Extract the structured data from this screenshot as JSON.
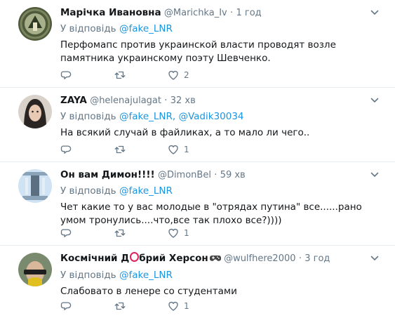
{
  "tweets": [
    {
      "name": "Марічка Ивановна",
      "handle": "@Marichka_Iv",
      "dot": "·",
      "time": "1 год",
      "reply_prefix": "У відповідь",
      "reply_mentions": [
        "@fake_LNR"
      ],
      "text": "Перфомапс против украинской власти проводят возле памятника украинскому поэту Шевченко.",
      "likes": "2",
      "retweets": "",
      "replies": ""
    },
    {
      "name": "ZAYA",
      "handle": "@helenajulagat",
      "dot": "·",
      "time": "32 хв",
      "reply_prefix": "У відповідь",
      "reply_mentions": [
        "@fake_LNR,",
        "@Vadik30034"
      ],
      "text": "На всякий случай в файликах, а то мало ли чего..",
      "likes": "1",
      "retweets": "",
      "replies": ""
    },
    {
      "name": "Он вам Димон!!!!",
      "handle": "@DimonBel",
      "dot": "·",
      "time": "59 хв",
      "reply_prefix": "У відповідь",
      "reply_mentions": [
        "@fake_LNR"
      ],
      "text": "Чет какие то у вас молодые в \"отрядах путина\" все......рано умом тронулись....что,все так плохо все?))))",
      "likes": "1",
      "retweets": "",
      "replies": ""
    },
    {
      "name_part1": "Космічний Д",
      "name_part2": "брий Херсон",
      "handle": "@wulfhere2000",
      "dot": "·",
      "time": "3 год",
      "reply_prefix": "У відповідь",
      "reply_mentions": [
        "@fake_LNR"
      ],
      "text": "Слабовато в ленере со студентами",
      "likes": "1",
      "retweets": "",
      "replies": ""
    }
  ],
  "icons": {
    "reply": "reply-icon",
    "retweet": "retweet-icon",
    "like": "heart-icon",
    "more": "chevron-down-icon"
  },
  "colors": {
    "icon": "#657786",
    "link": "#1b95e0",
    "divider": "#e6ecf0"
  }
}
